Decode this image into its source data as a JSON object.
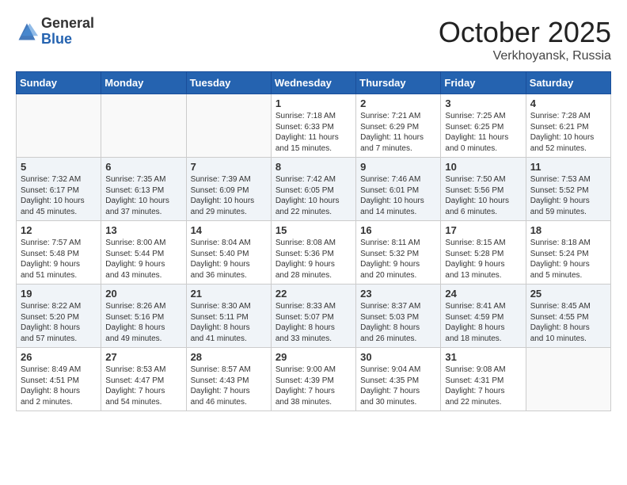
{
  "header": {
    "logo_general": "General",
    "logo_blue": "Blue",
    "month": "October 2025",
    "location": "Verkhoyansk, Russia"
  },
  "days_of_week": [
    "Sunday",
    "Monday",
    "Tuesday",
    "Wednesday",
    "Thursday",
    "Friday",
    "Saturday"
  ],
  "weeks": [
    [
      {
        "day": "",
        "info": ""
      },
      {
        "day": "",
        "info": ""
      },
      {
        "day": "",
        "info": ""
      },
      {
        "day": "1",
        "info": "Sunrise: 7:18 AM\nSunset: 6:33 PM\nDaylight: 11 hours\nand 15 minutes."
      },
      {
        "day": "2",
        "info": "Sunrise: 7:21 AM\nSunset: 6:29 PM\nDaylight: 11 hours\nand 7 minutes."
      },
      {
        "day": "3",
        "info": "Sunrise: 7:25 AM\nSunset: 6:25 PM\nDaylight: 11 hours\nand 0 minutes."
      },
      {
        "day": "4",
        "info": "Sunrise: 7:28 AM\nSunset: 6:21 PM\nDaylight: 10 hours\nand 52 minutes."
      }
    ],
    [
      {
        "day": "5",
        "info": "Sunrise: 7:32 AM\nSunset: 6:17 PM\nDaylight: 10 hours\nand 45 minutes."
      },
      {
        "day": "6",
        "info": "Sunrise: 7:35 AM\nSunset: 6:13 PM\nDaylight: 10 hours\nand 37 minutes."
      },
      {
        "day": "7",
        "info": "Sunrise: 7:39 AM\nSunset: 6:09 PM\nDaylight: 10 hours\nand 29 minutes."
      },
      {
        "day": "8",
        "info": "Sunrise: 7:42 AM\nSunset: 6:05 PM\nDaylight: 10 hours\nand 22 minutes."
      },
      {
        "day": "9",
        "info": "Sunrise: 7:46 AM\nSunset: 6:01 PM\nDaylight: 10 hours\nand 14 minutes."
      },
      {
        "day": "10",
        "info": "Sunrise: 7:50 AM\nSunset: 5:56 PM\nDaylight: 10 hours\nand 6 minutes."
      },
      {
        "day": "11",
        "info": "Sunrise: 7:53 AM\nSunset: 5:52 PM\nDaylight: 9 hours\nand 59 minutes."
      }
    ],
    [
      {
        "day": "12",
        "info": "Sunrise: 7:57 AM\nSunset: 5:48 PM\nDaylight: 9 hours\nand 51 minutes."
      },
      {
        "day": "13",
        "info": "Sunrise: 8:00 AM\nSunset: 5:44 PM\nDaylight: 9 hours\nand 43 minutes."
      },
      {
        "day": "14",
        "info": "Sunrise: 8:04 AM\nSunset: 5:40 PM\nDaylight: 9 hours\nand 36 minutes."
      },
      {
        "day": "15",
        "info": "Sunrise: 8:08 AM\nSunset: 5:36 PM\nDaylight: 9 hours\nand 28 minutes."
      },
      {
        "day": "16",
        "info": "Sunrise: 8:11 AM\nSunset: 5:32 PM\nDaylight: 9 hours\nand 20 minutes."
      },
      {
        "day": "17",
        "info": "Sunrise: 8:15 AM\nSunset: 5:28 PM\nDaylight: 9 hours\nand 13 minutes."
      },
      {
        "day": "18",
        "info": "Sunrise: 8:18 AM\nSunset: 5:24 PM\nDaylight: 9 hours\nand 5 minutes."
      }
    ],
    [
      {
        "day": "19",
        "info": "Sunrise: 8:22 AM\nSunset: 5:20 PM\nDaylight: 8 hours\nand 57 minutes."
      },
      {
        "day": "20",
        "info": "Sunrise: 8:26 AM\nSunset: 5:16 PM\nDaylight: 8 hours\nand 49 minutes."
      },
      {
        "day": "21",
        "info": "Sunrise: 8:30 AM\nSunset: 5:11 PM\nDaylight: 8 hours\nand 41 minutes."
      },
      {
        "day": "22",
        "info": "Sunrise: 8:33 AM\nSunset: 5:07 PM\nDaylight: 8 hours\nand 33 minutes."
      },
      {
        "day": "23",
        "info": "Sunrise: 8:37 AM\nSunset: 5:03 PM\nDaylight: 8 hours\nand 26 minutes."
      },
      {
        "day": "24",
        "info": "Sunrise: 8:41 AM\nSunset: 4:59 PM\nDaylight: 8 hours\nand 18 minutes."
      },
      {
        "day": "25",
        "info": "Sunrise: 8:45 AM\nSunset: 4:55 PM\nDaylight: 8 hours\nand 10 minutes."
      }
    ],
    [
      {
        "day": "26",
        "info": "Sunrise: 8:49 AM\nSunset: 4:51 PM\nDaylight: 8 hours\nand 2 minutes."
      },
      {
        "day": "27",
        "info": "Sunrise: 8:53 AM\nSunset: 4:47 PM\nDaylight: 7 hours\nand 54 minutes."
      },
      {
        "day": "28",
        "info": "Sunrise: 8:57 AM\nSunset: 4:43 PM\nDaylight: 7 hours\nand 46 minutes."
      },
      {
        "day": "29",
        "info": "Sunrise: 9:00 AM\nSunset: 4:39 PM\nDaylight: 7 hours\nand 38 minutes."
      },
      {
        "day": "30",
        "info": "Sunrise: 9:04 AM\nSunset: 4:35 PM\nDaylight: 7 hours\nand 30 minutes."
      },
      {
        "day": "31",
        "info": "Sunrise: 9:08 AM\nSunset: 4:31 PM\nDaylight: 7 hours\nand 22 minutes."
      },
      {
        "day": "",
        "info": ""
      }
    ]
  ]
}
